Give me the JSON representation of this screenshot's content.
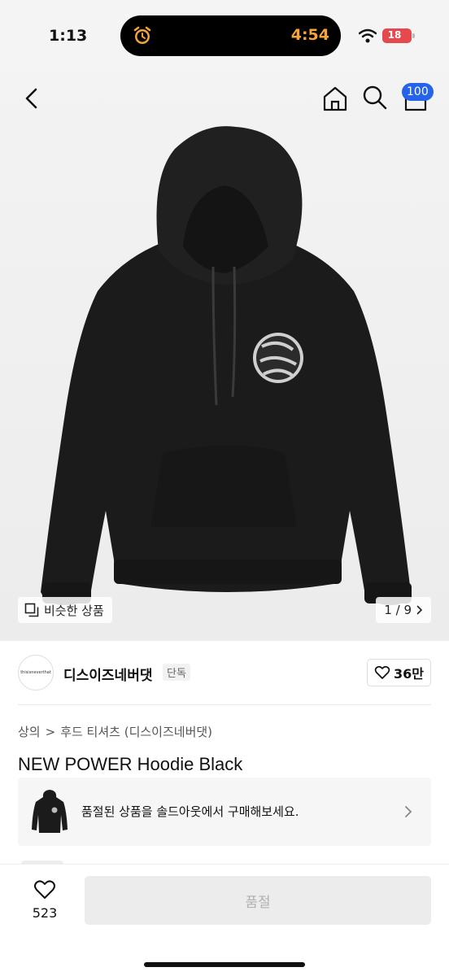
{
  "status_bar": {
    "time": "1:13",
    "island_time": "4:54",
    "battery": "18"
  },
  "nav": {
    "cart_count": "100"
  },
  "gallery": {
    "similar_label": "비슷한 상품",
    "page_indicator": "1 / 9"
  },
  "brand": {
    "logo_text": "thisisneverthat",
    "name": "디스이즈네버댓",
    "tag": "단독",
    "likes": "36만"
  },
  "breadcrumb": {
    "category": "상의",
    "separator": ">",
    "subcategory": "후드 티셔츠 (디스이즈네버댓)"
  },
  "product": {
    "title": "NEW POWER Hoodie Black"
  },
  "soldout_banner": {
    "text": "품절된 상품을 솔드아웃에서 구매해보세요."
  },
  "bottom_bar": {
    "wish_count": "523",
    "buy_label": "품절"
  },
  "colors": {
    "accent_badge": "#2563eb",
    "battery": "#e5484d",
    "island_text": "#f5a43a",
    "disabled_button": "#ececec"
  }
}
